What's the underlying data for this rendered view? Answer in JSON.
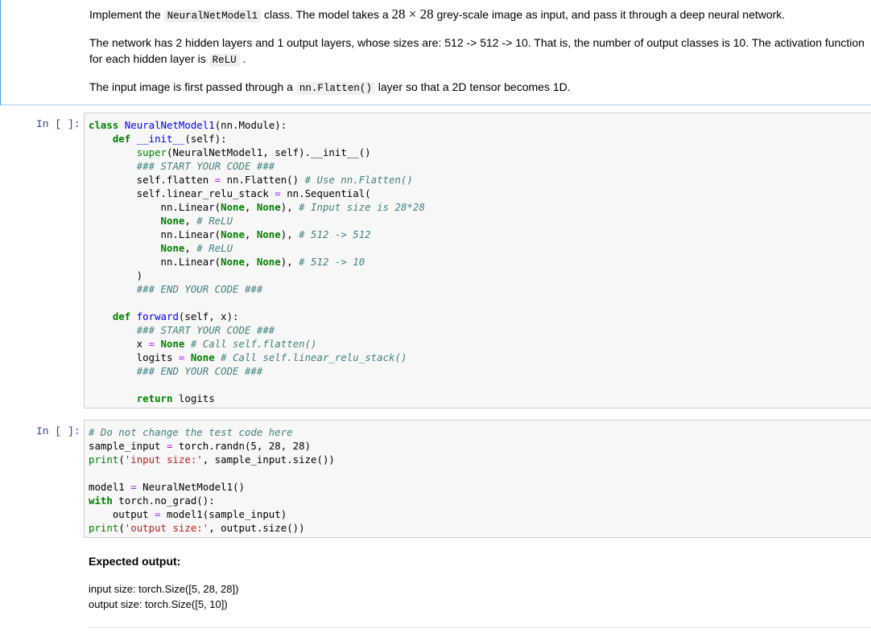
{
  "markdown": {
    "p1": {
      "pre": "Implement the ",
      "code": "NeuralNetModel1",
      "mid": " class. The model takes a ",
      "math": "28 × 28",
      "post": " grey-scale image as input, and pass it through a deep neural network."
    },
    "p2": {
      "line1": "The network has 2 hidden layers and 1 output layers, whose sizes are: 512 -> 512 -> 10. That is, the number of output classes is 10. The activation function",
      "line2_pre": "for each hidden layer is ",
      "line2_code": "ReLU",
      "line2_post": " ."
    },
    "p3": {
      "pre": "The input image is first passed through a ",
      "code": "nn.Flatten()",
      "post": " layer so that a 2D tensor becomes 1D."
    }
  },
  "cells": [
    {
      "prompt": "In [ ]:",
      "lines": [
        "class NeuralNetModel1(nn.Module):",
        "    def __init__(self):",
        "        super(NeuralNetModel1, self).__init__()",
        "        ### START YOUR CODE ###",
        "        self.flatten = nn.Flatten() # Use nn.Flatten()",
        "        self.linear_relu_stack = nn.Sequential(",
        "            nn.Linear(None, None), # Input size is 28*28",
        "            None, # ReLU",
        "            nn.Linear(None, None), # 512 -> 512",
        "            None, # ReLU",
        "            nn.Linear(None, None), # 512 -> 10",
        "        )",
        "        ### END YOUR CODE ###",
        "",
        "    def forward(self, x):",
        "        ### START YOUR CODE ###",
        "        x = None # Call self.flatten()",
        "        logits = None # Call self.linear_relu_stack()",
        "        ### END YOUR CODE ###",
        "",
        "        return logits"
      ]
    },
    {
      "prompt": "In [ ]:",
      "lines": [
        "# Do not change the test code here",
        "sample_input = torch.randn(5, 28, 28)",
        "print('input size:', sample_input.size())",
        "",
        "model1 = NeuralNetModel1()",
        "with torch.no_grad():",
        "    output = model1(sample_input)",
        "print('output size:', output.size())"
      ]
    }
  ],
  "expected": {
    "title": "Expected output:",
    "line1": "input size: torch.Size([5, 28, 28])",
    "line2": "output size: torch.Size([5, 10])"
  }
}
